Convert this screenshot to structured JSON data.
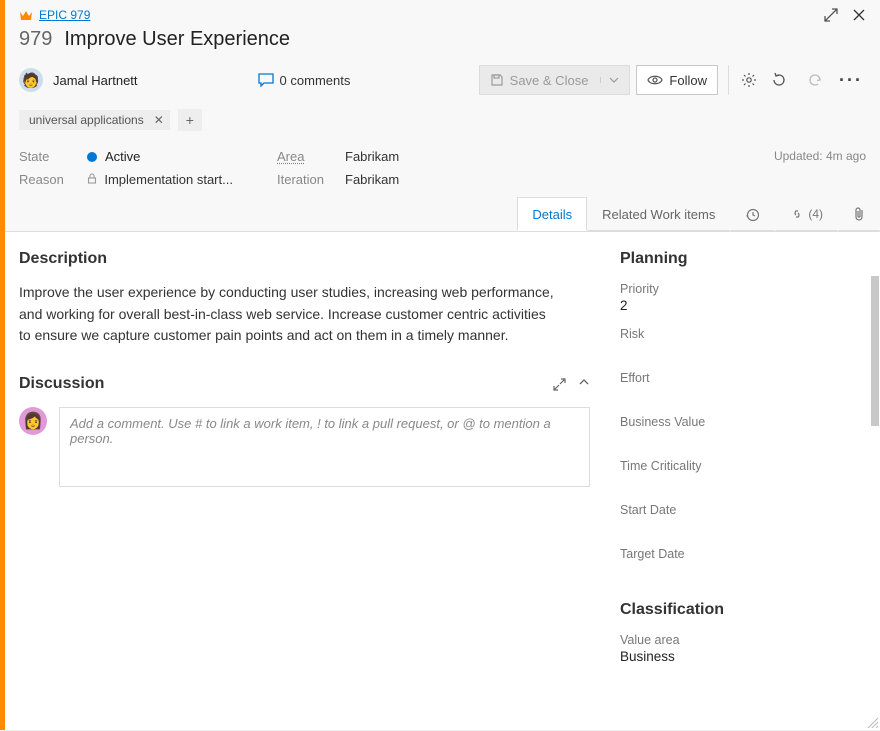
{
  "breadcrumb": {
    "epic_label": "EPIC 979"
  },
  "workitem": {
    "id": "979",
    "title": "Improve User Experience"
  },
  "assignee": {
    "name": "Jamal Hartnett"
  },
  "comments": {
    "label": "0 comments"
  },
  "actions": {
    "save_close": "Save & Close",
    "follow": "Follow"
  },
  "tags": {
    "tag1": "universal applications"
  },
  "meta": {
    "state_label": "State",
    "state_value": "Active",
    "reason_label": "Reason",
    "reason_value": "Implementation start...",
    "area_label": "Area",
    "area_value": "Fabrikam",
    "iteration_label": "Iteration",
    "iteration_value": "Fabrikam",
    "updated": "Updated: 4m ago"
  },
  "tabs": {
    "details": "Details",
    "related": "Related Work items",
    "links_count": "(4)"
  },
  "description": {
    "heading": "Description",
    "body": "Improve the user experience by conducting user studies, increasing web performance, and working for overall best-in-class web service. Increase customer centric activities to ensure we capture customer pain points and act on them in a timely manner."
  },
  "discussion": {
    "heading": "Discussion",
    "placeholder": "Add a comment. Use # to link a work item, ! to link a pull request, or @ to mention a person."
  },
  "planning": {
    "heading": "Planning",
    "priority_label": "Priority",
    "priority_value": "2",
    "risk_label": "Risk",
    "effort_label": "Effort",
    "business_value_label": "Business Value",
    "time_criticality_label": "Time Criticality",
    "start_date_label": "Start Date",
    "target_date_label": "Target Date"
  },
  "classification": {
    "heading": "Classification",
    "value_area_label": "Value area",
    "value_area_value": "Business"
  }
}
